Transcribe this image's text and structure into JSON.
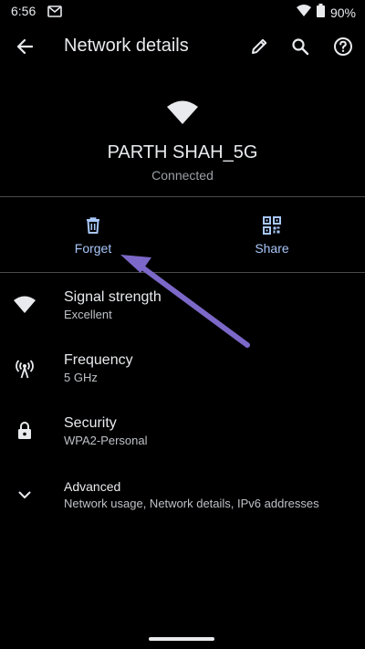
{
  "status_bar": {
    "time": "6:56",
    "battery": "90%",
    "icons": [
      "notification-icon",
      "wifi-signal-icon",
      "battery-icon"
    ]
  },
  "app_bar": {
    "title": "Network details",
    "icons": [
      "back-arrow-icon",
      "edit-pencil-icon",
      "search-icon",
      "help-icon"
    ]
  },
  "network": {
    "name": "PARTH SHAH_5G",
    "status": "Connected"
  },
  "actions": {
    "forget_label": "Forget",
    "share_label": "Share"
  },
  "details": [
    {
      "title": "Signal strength",
      "value": "Excellent",
      "icon": "wifi-icon"
    },
    {
      "title": "Frequency",
      "value": "5 GHz",
      "icon": "antenna-icon"
    },
    {
      "title": "Security",
      "value": "WPA2-Personal",
      "icon": "lock-icon"
    },
    {
      "title": "Advanced",
      "value": "Network usage, Network details, IPv6 addresses",
      "icon": "chevron-down-icon"
    }
  ],
  "colors": {
    "background": "#000000",
    "text_primary": "#e8eaed",
    "text_secondary": "#bdc1c6",
    "accent": "#a8c7fa",
    "annotation_arrow": "#7b68c8"
  }
}
